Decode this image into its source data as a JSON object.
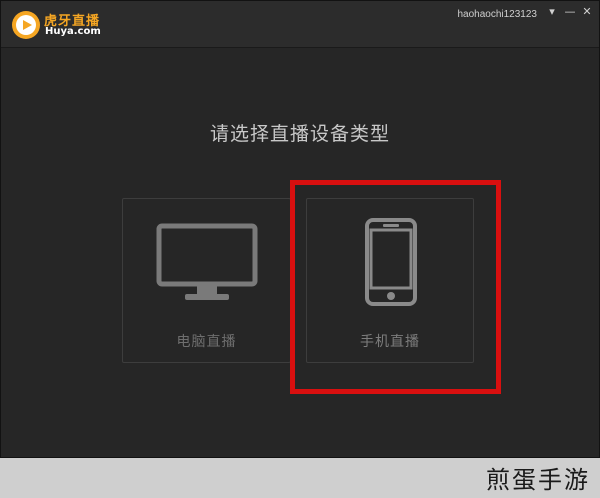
{
  "titlebar": {
    "logo_cn": "虎牙直播",
    "logo_en": "Huya.com",
    "username": "haohaochi123123",
    "controls": {
      "dropdown_icon": "chevron-down-icon",
      "minimize_icon": "minimize-icon",
      "close_icon": "close-icon",
      "dropdown_glyph": "▾",
      "minimize_glyph": "—",
      "close_glyph": "✕"
    }
  },
  "main": {
    "prompt": "请选择直播设备类型",
    "options": [
      {
        "label": "电脑直播",
        "icon": "monitor-icon",
        "selected": false
      },
      {
        "label": "手机直播",
        "icon": "smartphone-icon",
        "selected": true
      }
    ]
  },
  "watermark": "煎蛋手游",
  "colors": {
    "background": "#262626",
    "accent_logo": "#f5a623",
    "highlight": "#d80f0f",
    "icon_gray": "#7a7a7a"
  }
}
